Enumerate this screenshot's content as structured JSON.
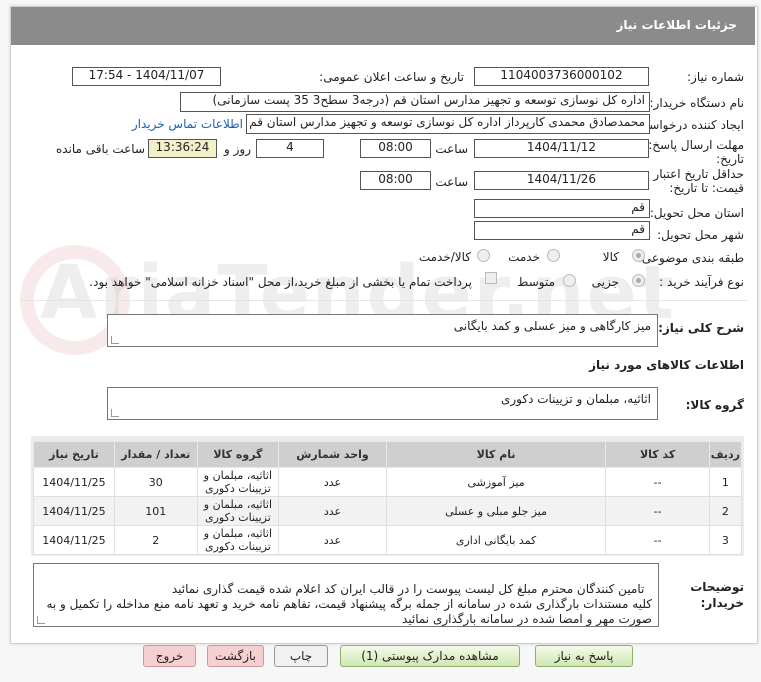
{
  "header": {
    "title": "جزئیات اطلاعات نیاز"
  },
  "need_number": {
    "label": "شماره نیاز:",
    "value": "1104003736000102"
  },
  "announce_datetime": {
    "label": "تاریخ و ساعت اعلان عمومی:",
    "value": "1404/11/07 - 17:54"
  },
  "buyer_org": {
    "label": "نام دستگاه خریدار:",
    "value": "اداره کل نوسازی   توسعه و تجهیز مدارس استان قم (درجه3 سطح3  35 پست سازمانی)"
  },
  "requester": {
    "label": "ایجاد کننده درخواست:",
    "value": "محمدصادق محمدی کارپرداز  اداره کل نوسازی   توسعه و تجهیز مدارس استان قم",
    "contact_link": "اطلاعات تماس خریدار"
  },
  "deadline": {
    "label_line1": "مهلت ارسال پاسخ: تا",
    "label_line2": "تاریخ:",
    "date": "1404/11/12",
    "time_label": "ساعت",
    "time": "08:00",
    "days": "4",
    "days_label": "روز و",
    "remaining": "13:36:24",
    "remaining_label": "ساعت باقی مانده"
  },
  "price_validity": {
    "label_line1": "حداقل تاریخ اعتبار",
    "label_line2": "قیمت: تا تاریخ:",
    "date": "1404/11/26",
    "time_label": "ساعت",
    "time": "08:00"
  },
  "province": {
    "label": "استان محل تحویل:",
    "value": "قم"
  },
  "city": {
    "label": "شهر محل تحویل:",
    "value": "قم"
  },
  "category": {
    "label": "طبقه بندی موضوعی:",
    "options": [
      "کالا",
      "خدمت",
      "کالا/خدمت"
    ],
    "selected": "کالا"
  },
  "purchase_process": {
    "label": "نوع فرآیند خرید :",
    "options": [
      "جزیی",
      "متوسط"
    ],
    "selected": "جزیی",
    "treasury_note": "پرداخت تمام یا بخشی از مبلغ خرید،از محل \"اسناد خزانه اسلامی\" خواهد بود."
  },
  "need_description": {
    "label": "شرح کلی نیاز:",
    "value": "میز کارگاهی و میز عسلی و کمد بایگانی"
  },
  "goods_section": {
    "title": "اطلاعات کالاهای مورد نیاز"
  },
  "goods_group": {
    "label": "گروه کالا:",
    "value": "اثاثیه، مبلمان و تزیینات دکوری"
  },
  "table": {
    "headers": [
      "ردیف",
      "کد کالا",
      "نام کالا",
      "واحد شمارش",
      "گروه کالا",
      "تعداد / مقدار",
      "تاریخ نیاز"
    ],
    "rows": [
      [
        "1",
        "--",
        "میز آموزشی",
        "عدد",
        "اثاثیه، مبلمان و تزیینات دکوری",
        "30",
        "1404/11/25"
      ],
      [
        "2",
        "--",
        "میز جلو مبلی و عسلی",
        "عدد",
        "اثاثیه، مبلمان و تزیینات دکوری",
        "101",
        "1404/11/25"
      ],
      [
        "3",
        "--",
        "کمد بایگانی اداری",
        "عدد",
        "اثاثیه، مبلمان و تزیینات دکوری",
        "2",
        "1404/11/25"
      ]
    ]
  },
  "buyer_notes": {
    "label_line1": "توضیحات",
    "label_line2": "خریدار:",
    "value": "تامین کنندگان محترم مبلغ کل لیست پیوست را در قالب ایران کد اعلام شده قیمت گذاری نمائید\nکلیه مستندات بارگذاری شده در سامانه از جمله برگه پیشنهاد قیمت، تفاهم نامه خرید و تعهد نامه منع مداخله را تکمیل و به صورت مهر و امضا شده در سامانه بارگذاری نمائید"
  },
  "buttons": {
    "reply": "پاسخ به نیاز",
    "attachments": "مشاهده مدارک پیوستی (1)",
    "print": "چاپ",
    "back": "بازگشت",
    "exit": "خروج"
  },
  "watermark": "AriaTender.net",
  "colors": {
    "header_bg": "#8b8b8b",
    "remaining_bg": "#f3efc8",
    "link": "#1a5fb4",
    "exit_bg": "#f6d0d0",
    "reply_bg": "#cfe6b4"
  }
}
